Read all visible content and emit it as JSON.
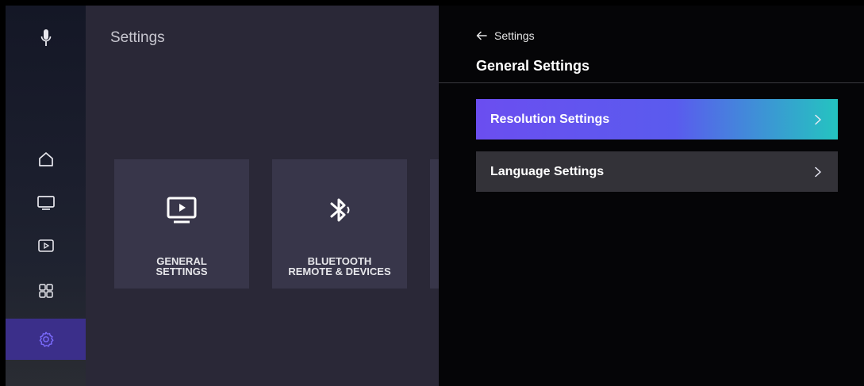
{
  "nav_rail": {
    "items": [
      {
        "icon": "microphone-icon"
      },
      {
        "icon": "home-icon"
      },
      {
        "icon": "tv-icon"
      },
      {
        "icon": "play-box-icon"
      },
      {
        "icon": "grid-icon"
      },
      {
        "icon": "gear-icon",
        "selected": true
      }
    ],
    "selected_color": "#3b2f8a"
  },
  "settings_page": {
    "title": "Settings",
    "tiles": [
      {
        "label": "GENERAL\nSETTINGS",
        "icon": "monitor-play-icon"
      },
      {
        "label": "BLUETOOTH\nREMOTE & DEVICES",
        "icon": "bluetooth-icon"
      }
    ]
  },
  "panel": {
    "back_label": "Settings",
    "title": "General Settings",
    "items": [
      {
        "label": "Resolution Settings",
        "active": true
      },
      {
        "label": "Language Settings",
        "active": false
      }
    ],
    "accent_gradient": [
      "#6b4ef0",
      "#24c4c0"
    ]
  }
}
